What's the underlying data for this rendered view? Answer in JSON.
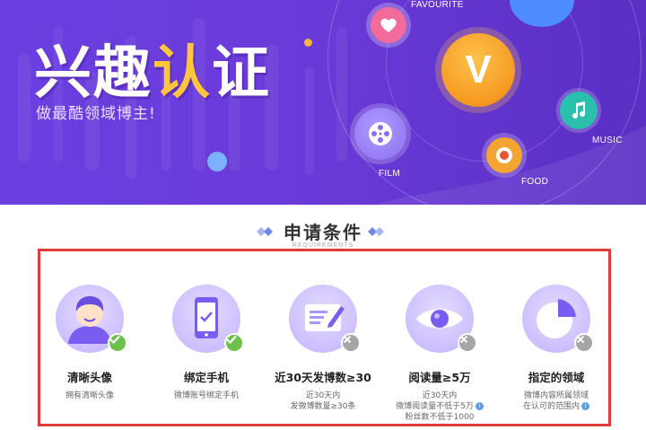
{
  "banner": {
    "title_part1": "兴趣",
    "title_part2": "认",
    "title_part3": "证",
    "subtitle": "做最酷领域博主!",
    "categories": {
      "favourite": "FAVOURITE",
      "film": "FILM",
      "food": "FOOD",
      "music": "MUSIC"
    },
    "center_logo": "V"
  },
  "section": {
    "title": "申请条件",
    "subtitle": "REQUIREMENTS"
  },
  "colors": {
    "accent_purple": "#6a3fe0",
    "border_red": "#e03b3b",
    "success_green": "#6cc24a",
    "failed_gray": "#a5a5a5"
  },
  "requirements": [
    {
      "name": "清晰头像",
      "icon": "avatar-icon",
      "status": "met",
      "desc": [
        "拥有清晰头像"
      ]
    },
    {
      "name": "绑定手机",
      "icon": "phone-icon",
      "status": "met",
      "desc": [
        "微博账号绑定手机"
      ]
    },
    {
      "name": "近30天发博数≥30",
      "icon": "edit-icon",
      "status": "unmet",
      "desc": [
        "近30天内",
        "发微博数量≥30条"
      ]
    },
    {
      "name": "阅读量≥5万",
      "icon": "eye-icon",
      "status": "unmet",
      "desc": [
        "近30天内",
        "微博阅读量不低于5万",
        "粉丝数不低于1000"
      ]
    },
    {
      "name": "指定的领域",
      "icon": "pie-chart-icon",
      "status": "unmet",
      "desc": [
        "微博内容所属领域",
        "在认可的范围内"
      ]
    }
  ]
}
